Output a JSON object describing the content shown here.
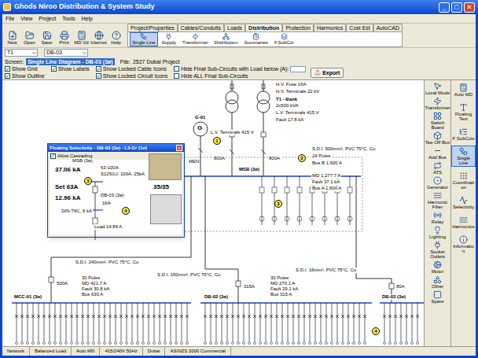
{
  "window": {
    "title": "Ghods Niroo Distribution & System Study",
    "controls": [
      "_",
      "□",
      "×"
    ]
  },
  "menu": [
    "File",
    "View",
    "Project",
    "Tools",
    "Help"
  ],
  "toolbar": [
    "New",
    "Open",
    "Save",
    "Print",
    "MD Vd",
    "Internet",
    "Help"
  ],
  "tabs": [
    {
      "label": "Project/Properties",
      "selected": false
    },
    {
      "label": "Cables/Conduits",
      "selected": false
    },
    {
      "label": "Loads",
      "selected": false
    },
    {
      "label": "Distribution",
      "selected": true
    },
    {
      "label": "Protection",
      "selected": false
    },
    {
      "label": "Harmonics",
      "selected": false
    },
    {
      "label": "Cost Est",
      "selected": false
    },
    {
      "label": "AutoCAD",
      "selected": false
    }
  ],
  "subtools": [
    {
      "label": "Single Line",
      "selected": true
    },
    {
      "label": "Supply",
      "selected": false
    },
    {
      "label": "Transformer",
      "selected": false
    },
    {
      "label": "Distribution",
      "selected": false
    },
    {
      "label": "Summaries",
      "selected": false
    },
    {
      "label": "F.SubCct",
      "selected": false
    }
  ],
  "selectors": [
    "T1",
    "DB-03"
  ],
  "screen": {
    "label": "Screen:",
    "value": "Single Line Diagram - DB-03 (3ø)",
    "file_label": "File:",
    "file": "2527 Dubai Project"
  },
  "options": [
    {
      "label": "Show Grid",
      "checked": true,
      "kind": "checkbox"
    },
    {
      "label": "Show Labels",
      "checked": true,
      "kind": "checkbox"
    },
    {
      "label": "Show Locked Cable Icons",
      "checked": true,
      "kind": "checkbox"
    },
    {
      "label": "Hide Final Sub-Circuits with Load below (A):",
      "checked": false,
      "kind": "field"
    },
    {
      "label": "Show Outline",
      "checked": true,
      "kind": "checkbox"
    },
    {
      "label": "Show Locked Circuit Icons",
      "checked": true,
      "kind": "checkbox"
    },
    {
      "label": "Hide ALL Final Sub-Circuits",
      "checked": false,
      "kind": "checkbox"
    }
  ],
  "export": "Export",
  "palette": [
    "Local Mode",
    "Transformer",
    "Switch Board",
    "Tee-Off Box",
    "Add Bus",
    "ATS",
    "Generator",
    "Harmonic Filter",
    "Relay",
    "Lighting",
    "Socket Outlets",
    "Motor",
    "Other",
    "Spare"
  ],
  "sidebar": [
    {
      "label": "Auto MD",
      "selected": false
    },
    {
      "label": "Floating Text",
      "selected": false
    },
    {
      "label": "F SubCcts",
      "selected": false
    },
    {
      "label": "Single Line",
      "selected": true
    },
    {
      "label": "Coordination",
      "selected": false
    },
    {
      "label": "Selectivity",
      "selected": false
    },
    {
      "label": "Harmonics",
      "selected": false
    },
    {
      "label": "Information",
      "selected": false
    }
  ],
  "diagram": {
    "labels": [
      "H.V. Fuse 16A",
      "H.V. Terminals 22 kV",
      "T1 - Bank",
      "2x500 kVA",
      "L.V. Terminals 415 V",
      "Fault 17.8 kA",
      "G-01",
      "L.V. Terminals 415 V",
      "800A",
      "800A",
      "MEN",
      "S.D.I. 500mm², PVC 75°C, Cu",
      "24 Poles",
      "Bus B 1,600 A",
      "MSB (3ø)",
      "MD 1,277.7 A",
      "Fault 37.1 kA",
      "Bus A 1,600 A",
      "S.D.I. 240mm², PVC 75°C, Cu",
      "S.D.I. 150mm², PVC 75°C, Cu",
      "S.D.I. 16mm², PVC 75°C, Cu",
      "500A",
      "315A",
      "80A"
    ],
    "generator": "G",
    "markers": [
      "1",
      "2",
      "3",
      "4"
    ],
    "boards": [
      {
        "name": "MCC-01 (3ø)",
        "details": [
          "30 Poles",
          "MD 421.7 A",
          "Fault 30.8 kA",
          "Bus 630 A"
        ]
      },
      {
        "name": "DB-02 (3ø)",
        "details": [
          "30 Poles",
          "MD 270.1 A",
          "Fault 29.1 kA",
          "Bus 315 A"
        ]
      },
      {
        "name": "DB-03 (3ø)",
        "details": []
      }
    ]
  },
  "selectivity": {
    "title": "Floating Selectivity - DB-03 (3ø) - L3-Gr (1ø)",
    "close": "×",
    "cascading": {
      "label": "Allow Cascading",
      "checked": true
    },
    "labels": [
      "MSB (3ø)",
      "37.06 kA",
      "63-100A",
      "S125GJ, 100A, 25kA",
      "Set 63A",
      "12.96 kA",
      "DB-03 (3ø)",
      "16A",
      "DIN-T6C, 6 kA",
      "Load 14.89 A"
    ],
    "markers": [
      "3",
      "4"
    ],
    "count": "35/35"
  },
  "status_bar": [
    "Network",
    "Balanced Load",
    "Auto MD",
    "415/240V 50Hz",
    "Dubai",
    "AS/NZS 3000 Commercial"
  ]
}
